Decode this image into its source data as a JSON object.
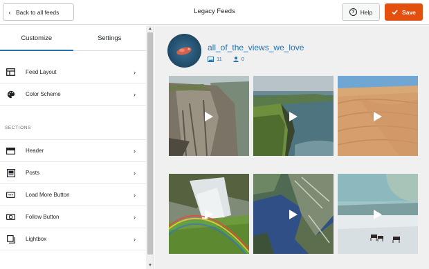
{
  "header": {
    "back_label": "Back to all feeds",
    "title": "Legacy Feeds",
    "help_label": "Help",
    "save_label": "Save",
    "accent_color": "#e34f0e"
  },
  "sidebar": {
    "tabs": [
      {
        "label": "Customize",
        "active": true
      },
      {
        "label": "Settings",
        "active": false
      }
    ],
    "top_items": [
      {
        "label": "Feed Layout",
        "icon": "layout-icon"
      },
      {
        "label": "Color Scheme",
        "icon": "palette-icon"
      }
    ],
    "section_label": "SECTIONS",
    "section_items": [
      {
        "label": "Header",
        "icon": "header-icon"
      },
      {
        "label": "Posts",
        "icon": "posts-icon"
      },
      {
        "label": "Load More Button",
        "icon": "load-more-icon"
      },
      {
        "label": "Follow Button",
        "icon": "follow-icon"
      },
      {
        "label": "Lightbox",
        "icon": "lightbox-icon"
      }
    ]
  },
  "preview": {
    "username": "all_of_the_views_we_love",
    "media_count": "11",
    "followers_count": "0",
    "tiles": [
      {
        "scene": "cliff-canyon",
        "video": true
      },
      {
        "scene": "green-sea-cliffs",
        "video": true
      },
      {
        "scene": "desert-dunes",
        "video": true
      },
      {
        "scene": "waterfall-rainbow",
        "video": true
      },
      {
        "scene": "aerial-fjord",
        "video": true
      },
      {
        "scene": "snowy-plain-horses",
        "video": true
      }
    ]
  }
}
